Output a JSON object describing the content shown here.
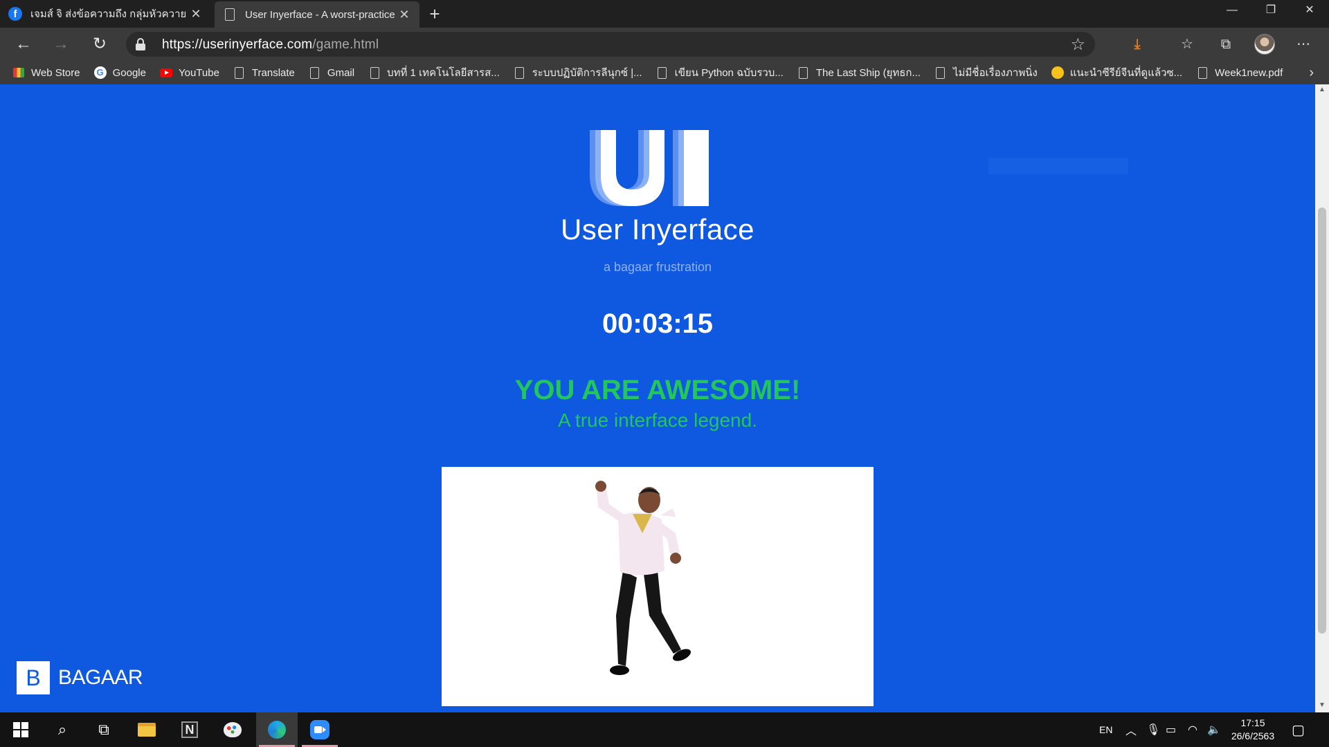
{
  "browser": {
    "tabs": [
      {
        "title": "เจมส์ จิ ส่งข้อความถึง กลุ่มหัวควาย",
        "icon": "facebook-icon",
        "active": false
      },
      {
        "title": "User Inyerface - A worst-practice",
        "icon": "page-icon",
        "active": true
      }
    ],
    "url_host": "https://userinyerface.com",
    "url_path": "/game.html",
    "bookmarks": [
      {
        "label": "Web Store",
        "icon": "web-store-icon"
      },
      {
        "label": "Google",
        "icon": "google-icon"
      },
      {
        "label": "YouTube",
        "icon": "youtube-icon"
      },
      {
        "label": "Translate",
        "icon": "page-icon"
      },
      {
        "label": "Gmail",
        "icon": "page-icon"
      },
      {
        "label": "บทที่ 1 เทคโนโลยีสารส...",
        "icon": "page-icon"
      },
      {
        "label": "ระบบปฏิบัติการลีนุกซ์ |...",
        "icon": "page-icon"
      },
      {
        "label": "เขียน Python ฉบับรวบ...",
        "icon": "page-icon"
      },
      {
        "label": "The Last Ship (ยุทธก...",
        "icon": "page-icon"
      },
      {
        "label": "ไม่มีชื่อเรื่องภาพนิ่ง",
        "icon": "page-icon"
      },
      {
        "label": "แนะนำซีรีย์จีนที่ดูแล้วซ...",
        "icon": "emoji-icon"
      },
      {
        "label": "Week1new.pdf",
        "icon": "page-icon"
      }
    ]
  },
  "page": {
    "logo_text": "UI",
    "title": "User Inyerface",
    "subtitle": "a bagaar frustration",
    "timer": "00:03:15",
    "headline": "YOU ARE AWESOME!",
    "tagline": "A true interface legend.",
    "footer_brand_letter": "B",
    "footer_brand": "BAGAAR",
    "colors": {
      "background": "#0f58e0",
      "success": "#22c55e"
    }
  },
  "taskbar": {
    "language": "EN",
    "time": "17:15",
    "date": "26/6/2563"
  }
}
